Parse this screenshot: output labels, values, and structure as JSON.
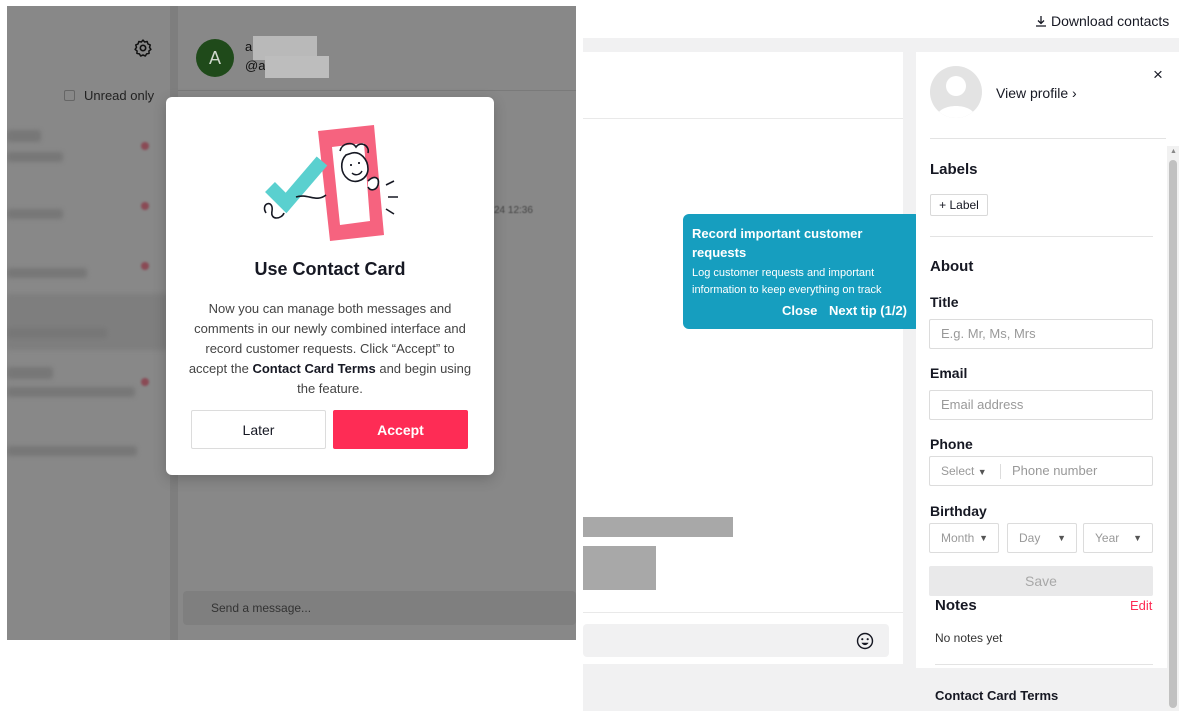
{
  "left_panel": {
    "unread_only": "Unread only",
    "chat_avatar_letter": "A",
    "chat_name": "a",
    "chat_handle": "@a",
    "chat_time": "24 12:36",
    "message_placeholder": "Send a message..."
  },
  "modal": {
    "title": "Use Contact Card",
    "desc_part1": "Now you can manage both messages and comments in our newly combined interface and record customer requests. Click “Accept” to accept the ",
    "desc_bold": "Contact Card Terms",
    "desc_part2": " and begin using the feature.",
    "later_label": "Later",
    "accept_label": "Accept",
    "accept_color": "#fe2c55"
  },
  "header": {
    "download_label": "Download contacts",
    "download_icon": "download-icon"
  },
  "tooltip": {
    "title": "Record important customer requests",
    "body": "Log customer requests and important information to keep everything on track",
    "close_label": "Close",
    "next_label": "Next tip (1/2)",
    "color": "#169ebf"
  },
  "contact_card": {
    "view_profile": "View profile",
    "close_icon": "×",
    "labels_title": "Labels",
    "add_label": "Label",
    "about_title": "About",
    "title_label": "Title",
    "title_placeholder": "E.g. Mr, Ms, Mrs",
    "email_label": "Email",
    "email_placeholder": "Email address",
    "phone_label": "Phone",
    "phone_select": "Select",
    "phone_placeholder": "Phone number",
    "birthday_label": "Birthday",
    "month": "Month",
    "day": "Day",
    "year": "Year",
    "save_label": "Save",
    "notes_title": "Notes",
    "edit_label": "Edit",
    "no_notes": "No notes yet",
    "terms_label": "Contact Card Terms"
  }
}
